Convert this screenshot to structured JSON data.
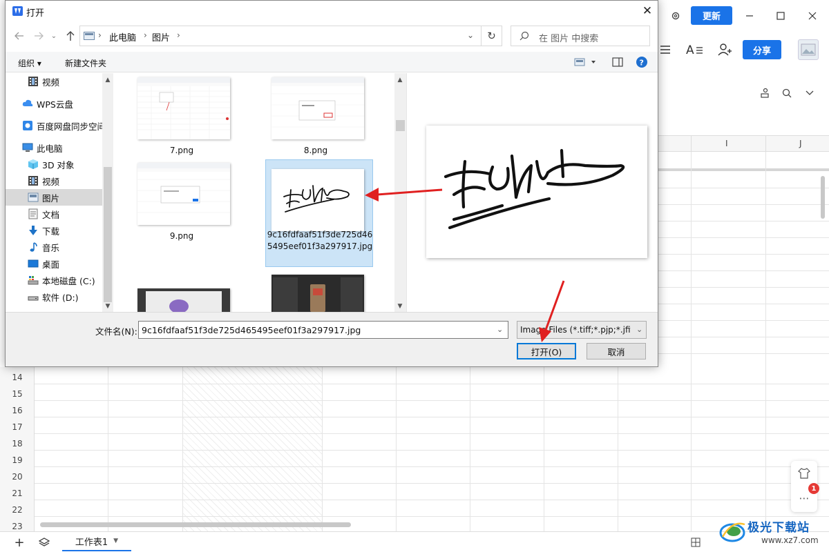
{
  "app": {
    "update_label": "更新",
    "share_label": "分享",
    "col_letters": [
      "I",
      "J"
    ],
    "row_numbers": [
      "14",
      "15",
      "16",
      "17",
      "18",
      "19",
      "20",
      "21",
      "22",
      "23"
    ],
    "sheet_tab": "工作表1",
    "badge_count": "1",
    "watermark_text": "极光下载站",
    "watermark_url": "www.xz7.com",
    "accent_color": "#1a73e8"
  },
  "dialog": {
    "title": "打开",
    "breadcrumb": [
      "此电脑",
      "图片"
    ],
    "search_placeholder": "在 图片 中搜索",
    "organize_label": "组织 ▾",
    "new_folder_label": "新建文件夹",
    "nav_items": [
      {
        "label": "视频",
        "icon": "video-icon"
      },
      {
        "label": "WPS云盘",
        "icon": "cloud-icon"
      },
      {
        "label": "百度网盘同步空间",
        "icon": "baidu-netdisk-icon"
      },
      {
        "label": "此电脑",
        "icon": "computer-icon"
      },
      {
        "label": "3D 对象",
        "icon": "cube-icon"
      },
      {
        "label": "视频",
        "icon": "video-icon"
      },
      {
        "label": "图片",
        "icon": "picture-icon"
      },
      {
        "label": "文档",
        "icon": "document-icon"
      },
      {
        "label": "下载",
        "icon": "download-icon"
      },
      {
        "label": "音乐",
        "icon": "music-icon"
      },
      {
        "label": "桌面",
        "icon": "desktop-icon"
      },
      {
        "label": "本地磁盘 (C:)",
        "icon": "drive-icon"
      },
      {
        "label": "软件 (D:)",
        "icon": "drive-icon"
      }
    ],
    "files": [
      {
        "name": "7.png"
      },
      {
        "name": "8.png"
      },
      {
        "name": "9.png"
      },
      {
        "name": "9c16fdfaaf51f3de725d465495eef01f3a297917.jpg"
      },
      {
        "name": ""
      },
      {
        "name": ""
      }
    ],
    "filename_label": "文件名(N):",
    "filename_value": "9c16fdfaaf51f3de725d465495eef01f3a297917.jpg",
    "filetype_value": "Image Files (*.tiff;*.pjp;*.jfif;*.",
    "open_button": "打开(O)",
    "cancel_button": "取消"
  }
}
